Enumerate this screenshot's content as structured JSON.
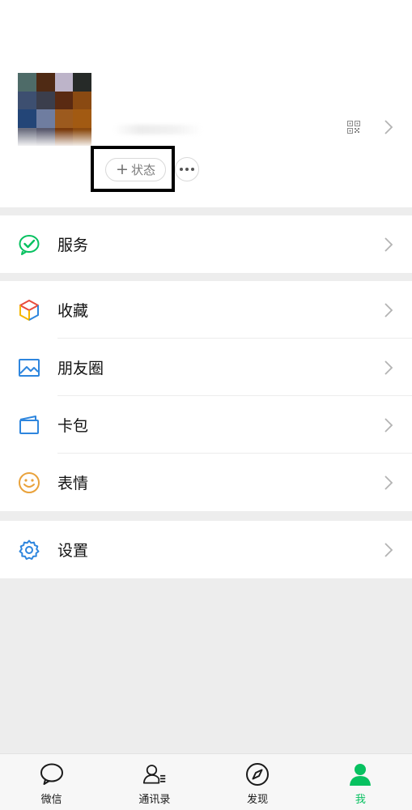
{
  "profile": {
    "status_label": "状态",
    "status_plus": "+",
    "avatar_colors": [
      "#4e6b68",
      "#4f2a14",
      "#bdb4c9",
      "#262a28",
      "#3d4f70",
      "#3b3e4c",
      "#5a2a12",
      "#8a4a12",
      "#234577",
      "#6f7da0",
      "#9c5a1e",
      "#a25a12",
      "#6c6f80",
      "#5a5a6e",
      "#7a3a0c",
      "#8b4a10"
    ]
  },
  "groups": [
    {
      "items": [
        {
          "label": "服务",
          "icon": "service-icon"
        }
      ]
    },
    {
      "items": [
        {
          "label": "收藏",
          "icon": "favorites-cube-icon"
        },
        {
          "label": "朋友圈",
          "icon": "moments-picture-icon"
        },
        {
          "label": "卡包",
          "icon": "card-wallet-icon"
        },
        {
          "label": "表情",
          "icon": "sticker-smiley-icon"
        }
      ]
    },
    {
      "items": [
        {
          "label": "设置",
          "icon": "settings-gear-icon"
        }
      ]
    }
  ],
  "tabs": [
    {
      "label": "微信",
      "icon": "chat-bubble-icon"
    },
    {
      "label": "通讯录",
      "icon": "contacts-icon"
    },
    {
      "label": "发现",
      "icon": "compass-icon"
    },
    {
      "label": "我",
      "icon": "person-icon",
      "active": true
    }
  ],
  "colors": {
    "accent": "#07c160",
    "background": "#ededed",
    "chevron": "#b3b3b3"
  }
}
